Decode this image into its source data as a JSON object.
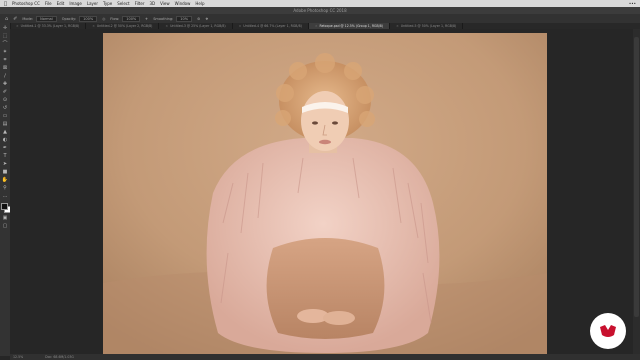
{
  "menubar": {
    "items": [
      "Photoshop CC",
      "File",
      "Edit",
      "Image",
      "Layer",
      "Type",
      "Select",
      "Filter",
      "3D",
      "View",
      "Window",
      "Help"
    ],
    "status": "•••"
  },
  "titlebar": {
    "title": "Adobe Photoshop CC 2018"
  },
  "options": {
    "mode_label": "Mode:",
    "mode_value": "Normal",
    "opacity_label": "Opacity:",
    "opacity_value": "100%",
    "flow_label": "Flow:",
    "flow_value": "100%",
    "smoothing_label": "Smoothing:",
    "smoothing_value": "10%"
  },
  "tabs": [
    {
      "label": "Untitled-1 @ 33.3% (Layer 1, RGB/8)",
      "active": false
    },
    {
      "label": "Untitled-2 @ 50% (Layer 2, RGB/8)",
      "active": false
    },
    {
      "label": "Untitled-3 @ 25% (Layer 1, RGB/8)",
      "active": false
    },
    {
      "label": "Untitled-4 @ 66.7% (Layer 1, RGB/8)",
      "active": false
    },
    {
      "label": "Retoque.psd @ 12.5% (Group 1, RGB/8)",
      "active": true
    },
    {
      "label": "Untitled-5 @ 50% (Layer 1, RGB/8)",
      "active": false
    }
  ],
  "tools": [
    {
      "icon": "move-tool-icon",
      "glyph": "✛"
    },
    {
      "icon": "marquee-tool-icon",
      "glyph": "⬚"
    },
    {
      "icon": "lasso-tool-icon",
      "glyph": "⌒"
    },
    {
      "icon": "quick-select-tool-icon",
      "glyph": "✶"
    },
    {
      "icon": "crop-tool-icon",
      "glyph": "⌗"
    },
    {
      "icon": "frame-tool-icon",
      "glyph": "⊠"
    },
    {
      "icon": "eyedropper-tool-icon",
      "glyph": "∕"
    },
    {
      "icon": "healing-brush-tool-icon",
      "glyph": "✚"
    },
    {
      "icon": "brush-tool-icon",
      "glyph": "✐"
    },
    {
      "icon": "clone-stamp-tool-icon",
      "glyph": "⊙"
    },
    {
      "icon": "history-brush-tool-icon",
      "glyph": "↺"
    },
    {
      "icon": "eraser-tool-icon",
      "glyph": "▭"
    },
    {
      "icon": "gradient-tool-icon",
      "glyph": "▤"
    },
    {
      "icon": "blur-tool-icon",
      "glyph": "▲"
    },
    {
      "icon": "dodge-tool-icon",
      "glyph": "◐"
    },
    {
      "icon": "pen-tool-icon",
      "glyph": "✒"
    },
    {
      "icon": "type-tool-icon",
      "glyph": "T"
    },
    {
      "icon": "path-select-tool-icon",
      "glyph": "➤"
    },
    {
      "icon": "shape-tool-icon",
      "glyph": "■"
    },
    {
      "icon": "hand-tool-icon",
      "glyph": "✋"
    },
    {
      "icon": "zoom-tool-icon",
      "glyph": "⚲"
    },
    {
      "icon": "more-tools-icon",
      "glyph": "…"
    }
  ],
  "statusbar": {
    "zoom": "12.5%",
    "doc": "Doc: 68.6M/1.03G"
  },
  "colors": {
    "accent": "#c8102e",
    "background": "#262626",
    "backdrop": "#c59a7a"
  }
}
